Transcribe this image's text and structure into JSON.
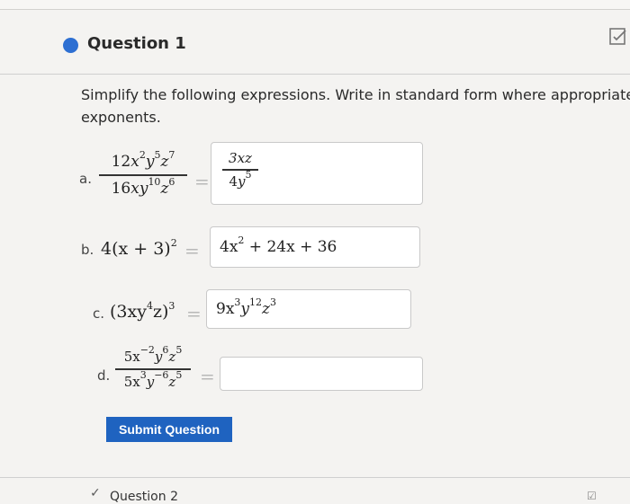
{
  "question": {
    "title": "Question 1"
  },
  "instructions": {
    "line1": "Simplify the following expressions. Write in standard form where appropriate",
    "line2": "exponents."
  },
  "items": {
    "a": {
      "label": "a.",
      "numerator": [
        "12",
        "x",
        "2",
        "y",
        "5",
        "z",
        "7"
      ],
      "denominator": [
        "16",
        "x",
        "y",
        "10",
        "z",
        "6"
      ],
      "answer_num": "3xz",
      "answer_den": [
        "4",
        "y",
        "5"
      ]
    },
    "b": {
      "label": "b.",
      "expr": [
        "4(x + 3)",
        "2"
      ],
      "answer": [
        "4x",
        "2",
        " + 24x + 36"
      ]
    },
    "c": {
      "label": "c.",
      "expr": [
        "(3xy",
        "4",
        "z)",
        "3"
      ],
      "answer": [
        "9x",
        "3",
        "y",
        "12",
        "z",
        "3"
      ]
    },
    "d": {
      "label": "d.",
      "numerator": [
        "5x",
        "−2",
        "y",
        "6",
        "z",
        "5"
      ],
      "denominator": [
        "5x",
        "3",
        "y",
        "−6",
        "z",
        "5"
      ],
      "answer": ""
    }
  },
  "equals": "=",
  "submit": {
    "label": "Submit Question"
  },
  "next": {
    "label": "Question 2"
  },
  "icons": {
    "edit": "edit-icon",
    "check": "check-icon"
  },
  "colors": {
    "accent": "#1f63c0",
    "dot": "#2d6fd2"
  }
}
